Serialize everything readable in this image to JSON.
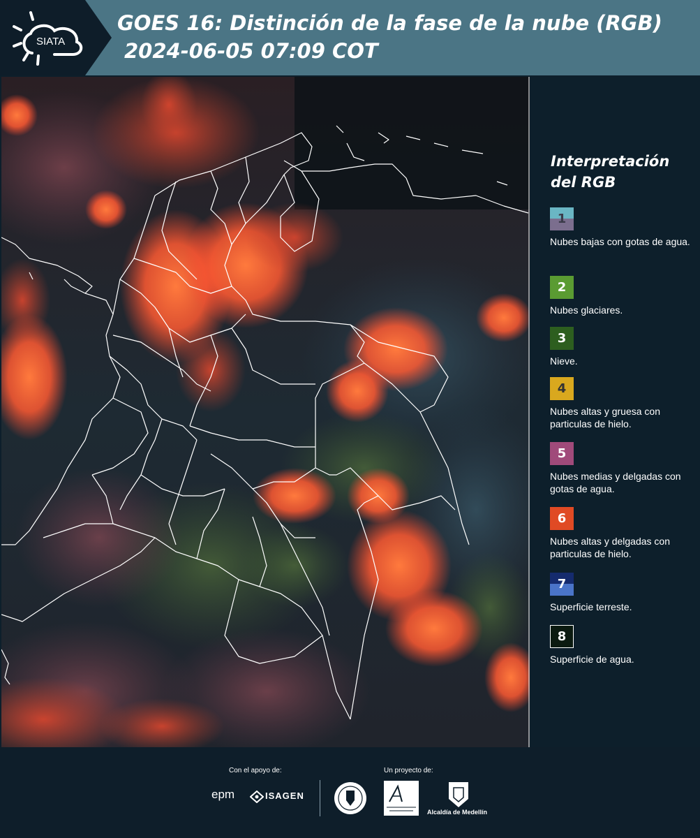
{
  "header": {
    "logo_text": "SIATA",
    "title": "GOES 16: Distinción de la fase de la nube (RGB)",
    "subtitle": "2024-06-05 07:09 COT"
  },
  "legend": {
    "title": "Interpretación del RGB",
    "items": [
      {
        "number": "1",
        "description": "Nubes bajas con gotas de agua.",
        "colors": [
          "#6ab6c4",
          "#7b6e8e"
        ],
        "number_color": "#3b3b4a"
      },
      {
        "number": "2",
        "description": "Nubes glaciares.",
        "colors": [
          "#5a9b32"
        ],
        "number_color": "#ffffff"
      },
      {
        "number": "3",
        "description": "Nieve.",
        "colors": [
          "#2d5e1f"
        ],
        "number_color": "#ffffff"
      },
      {
        "number": "4",
        "description": "Nubes altas y gruesa con particulas de hielo.",
        "colors": [
          "#d9a81e"
        ],
        "number_color": "#333333"
      },
      {
        "number": "5",
        "description": "Nubes medias y delgadas con gotas de agua.",
        "colors": [
          "#a04a7a"
        ],
        "number_color": "#ffffff"
      },
      {
        "number": "6",
        "description": "Nubes altas y delgadas con particulas de hielo.",
        "colors": [
          "#e04a24"
        ],
        "number_color": "#ffffff"
      },
      {
        "number": "7",
        "description": "Superficie terreste.",
        "colors": [
          "#152b6e",
          "#4a74c8"
        ],
        "number_color": "#ffffff"
      },
      {
        "number": "8",
        "description": "Superficie de agua.",
        "colors": [
          "#0b1a10"
        ],
        "number_color": "#ffffff"
      }
    ]
  },
  "footer": {
    "support_label": "Con el apoyo de:",
    "project_label": "Un proyecto de:",
    "sponsor_1": "epm",
    "sponsor_2": "ISAGEN",
    "partner_3": "Alcaldía de Medellín"
  }
}
